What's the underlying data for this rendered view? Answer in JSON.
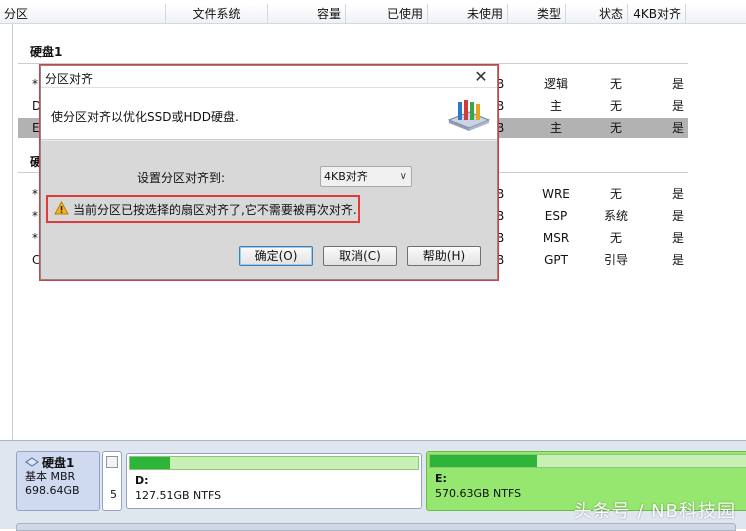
{
  "columns": [
    "分区",
    "文件系统",
    "容量",
    "已使用",
    "未使用",
    "类型",
    "状态",
    "4KB对齐"
  ],
  "disk1": {
    "title": "硬盘1",
    "rows": [
      {
        "name": "*",
        "unused_tail": "B",
        "type": "逻辑",
        "status": "无",
        "aligned": "是",
        "selected": false
      },
      {
        "name": "D",
        "unused_tail": "B",
        "type": "主",
        "status": "无",
        "aligned": "是",
        "selected": false
      },
      {
        "name": "E",
        "unused_tail": "B",
        "type": "主",
        "status": "无",
        "aligned": "是",
        "selected": true
      }
    ]
  },
  "disk2": {
    "title": "硬",
    "rows": [
      {
        "name": "*",
        "unused_tail": "B",
        "type": "WRE",
        "status": "无",
        "aligned": "是"
      },
      {
        "name": "*",
        "unused_tail": "B",
        "type": "ESP",
        "status": "系统",
        "aligned": "是"
      },
      {
        "name": "*",
        "unused_tail": "B",
        "type": "MSR",
        "status": "无",
        "aligned": "是"
      },
      {
        "name": "C",
        "unused_tail": "B",
        "type": "GPT",
        "status": "引导",
        "aligned": "是"
      }
    ]
  },
  "dialog": {
    "title": "分区对齐",
    "close": "✕",
    "description": "使分区对齐以优化SSD或HDD硬盘.",
    "set_label": "设置分区对齐到:",
    "select_value": "4KB对齐",
    "warning": "当前分区已按选择的扇区对齐了,它不需要被再次对齐.",
    "ok": "确定(O)",
    "cancel": "取消(C)",
    "help": "帮助(H)"
  },
  "diskmap": {
    "disk_name": "硬盘1",
    "disk_kind": "基本 MBR",
    "disk_size": "698.64GB",
    "small_slot_number": "5",
    "partitions": [
      {
        "label": "D:",
        "size": "127.51GB NTFS",
        "used_fraction": 0.14
      },
      {
        "label": "E:",
        "size": "570.63GB NTFS",
        "used_fraction": 0.33
      }
    ]
  },
  "watermark": "头条号 / NB科技园",
  "colors": {
    "selected_row": "#b2b2b2",
    "highlight_border": "#e03a3a",
    "partition_e": "#96e76f",
    "usage_fill": "#2db53a"
  }
}
